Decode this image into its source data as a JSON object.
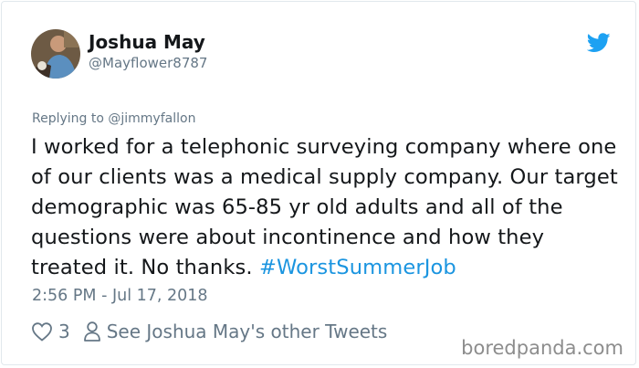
{
  "author": {
    "display_name": "Joshua May",
    "handle": "@Mayflower8787"
  },
  "reply_context": "Replying to @jimmyfallon",
  "tweet": {
    "text": "I worked for a telephonic surveying company where one of our clients was a medical supply company. Our target demographic was 65-85 yr old adults and all of the questions were about incontinence and how they treated it. No thanks.",
    "hashtag": "#WorstSummerJob"
  },
  "timestamp": "2:56 PM - Jul 17, 2018",
  "actions": {
    "like_count": "3",
    "profile_link": "See Joshua May's other Tweets"
  },
  "watermark": "boredpanda.com",
  "colors": {
    "twitter_blue": "#1da1f2",
    "hashtag": "#1b95e0",
    "muted_text": "#657786",
    "primary_text": "#14171a"
  },
  "icons": [
    "twitter-bird-icon",
    "heart-icon",
    "person-icon"
  ]
}
